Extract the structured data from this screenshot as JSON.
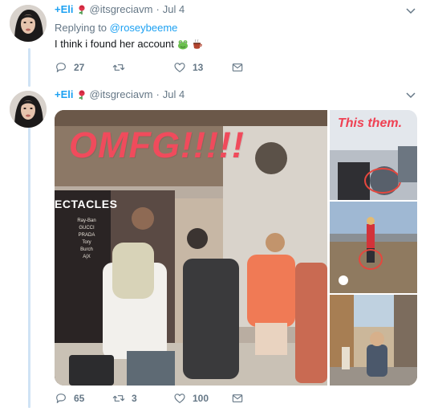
{
  "tweets": [
    {
      "name": "+Eli",
      "handle": "@itsgreciavm",
      "separator": "·",
      "date": "Jul 4",
      "replying_prefix": "Replying to",
      "replying_to": "@roseybeeme",
      "text": "I think i found her account",
      "emojis": [
        "frog-emoji",
        "hot-beverage-emoji"
      ],
      "actions": {
        "replies": "27",
        "retweets": "",
        "likes": "13"
      }
    },
    {
      "name": "+Eli",
      "handle": "@itsgreciavm",
      "separator": "·",
      "date": "Jul 4",
      "media": {
        "main_overlay_text": "OMFG!!!!!",
        "store_sign": "ECTACLES",
        "store_brands": [
          "Ray-Ban",
          "GUCCI",
          "PRADA",
          "Tory Burch",
          "A|X"
        ],
        "side_overlay_text": "This them."
      },
      "actions": {
        "replies": "65",
        "retweets": "3",
        "likes": "100"
      }
    }
  ],
  "colors": {
    "brand_blue": "#1da1f2",
    "muted": "#657786",
    "thread_line": "#cfe3f5",
    "overlay_red": "#f04b5c"
  }
}
